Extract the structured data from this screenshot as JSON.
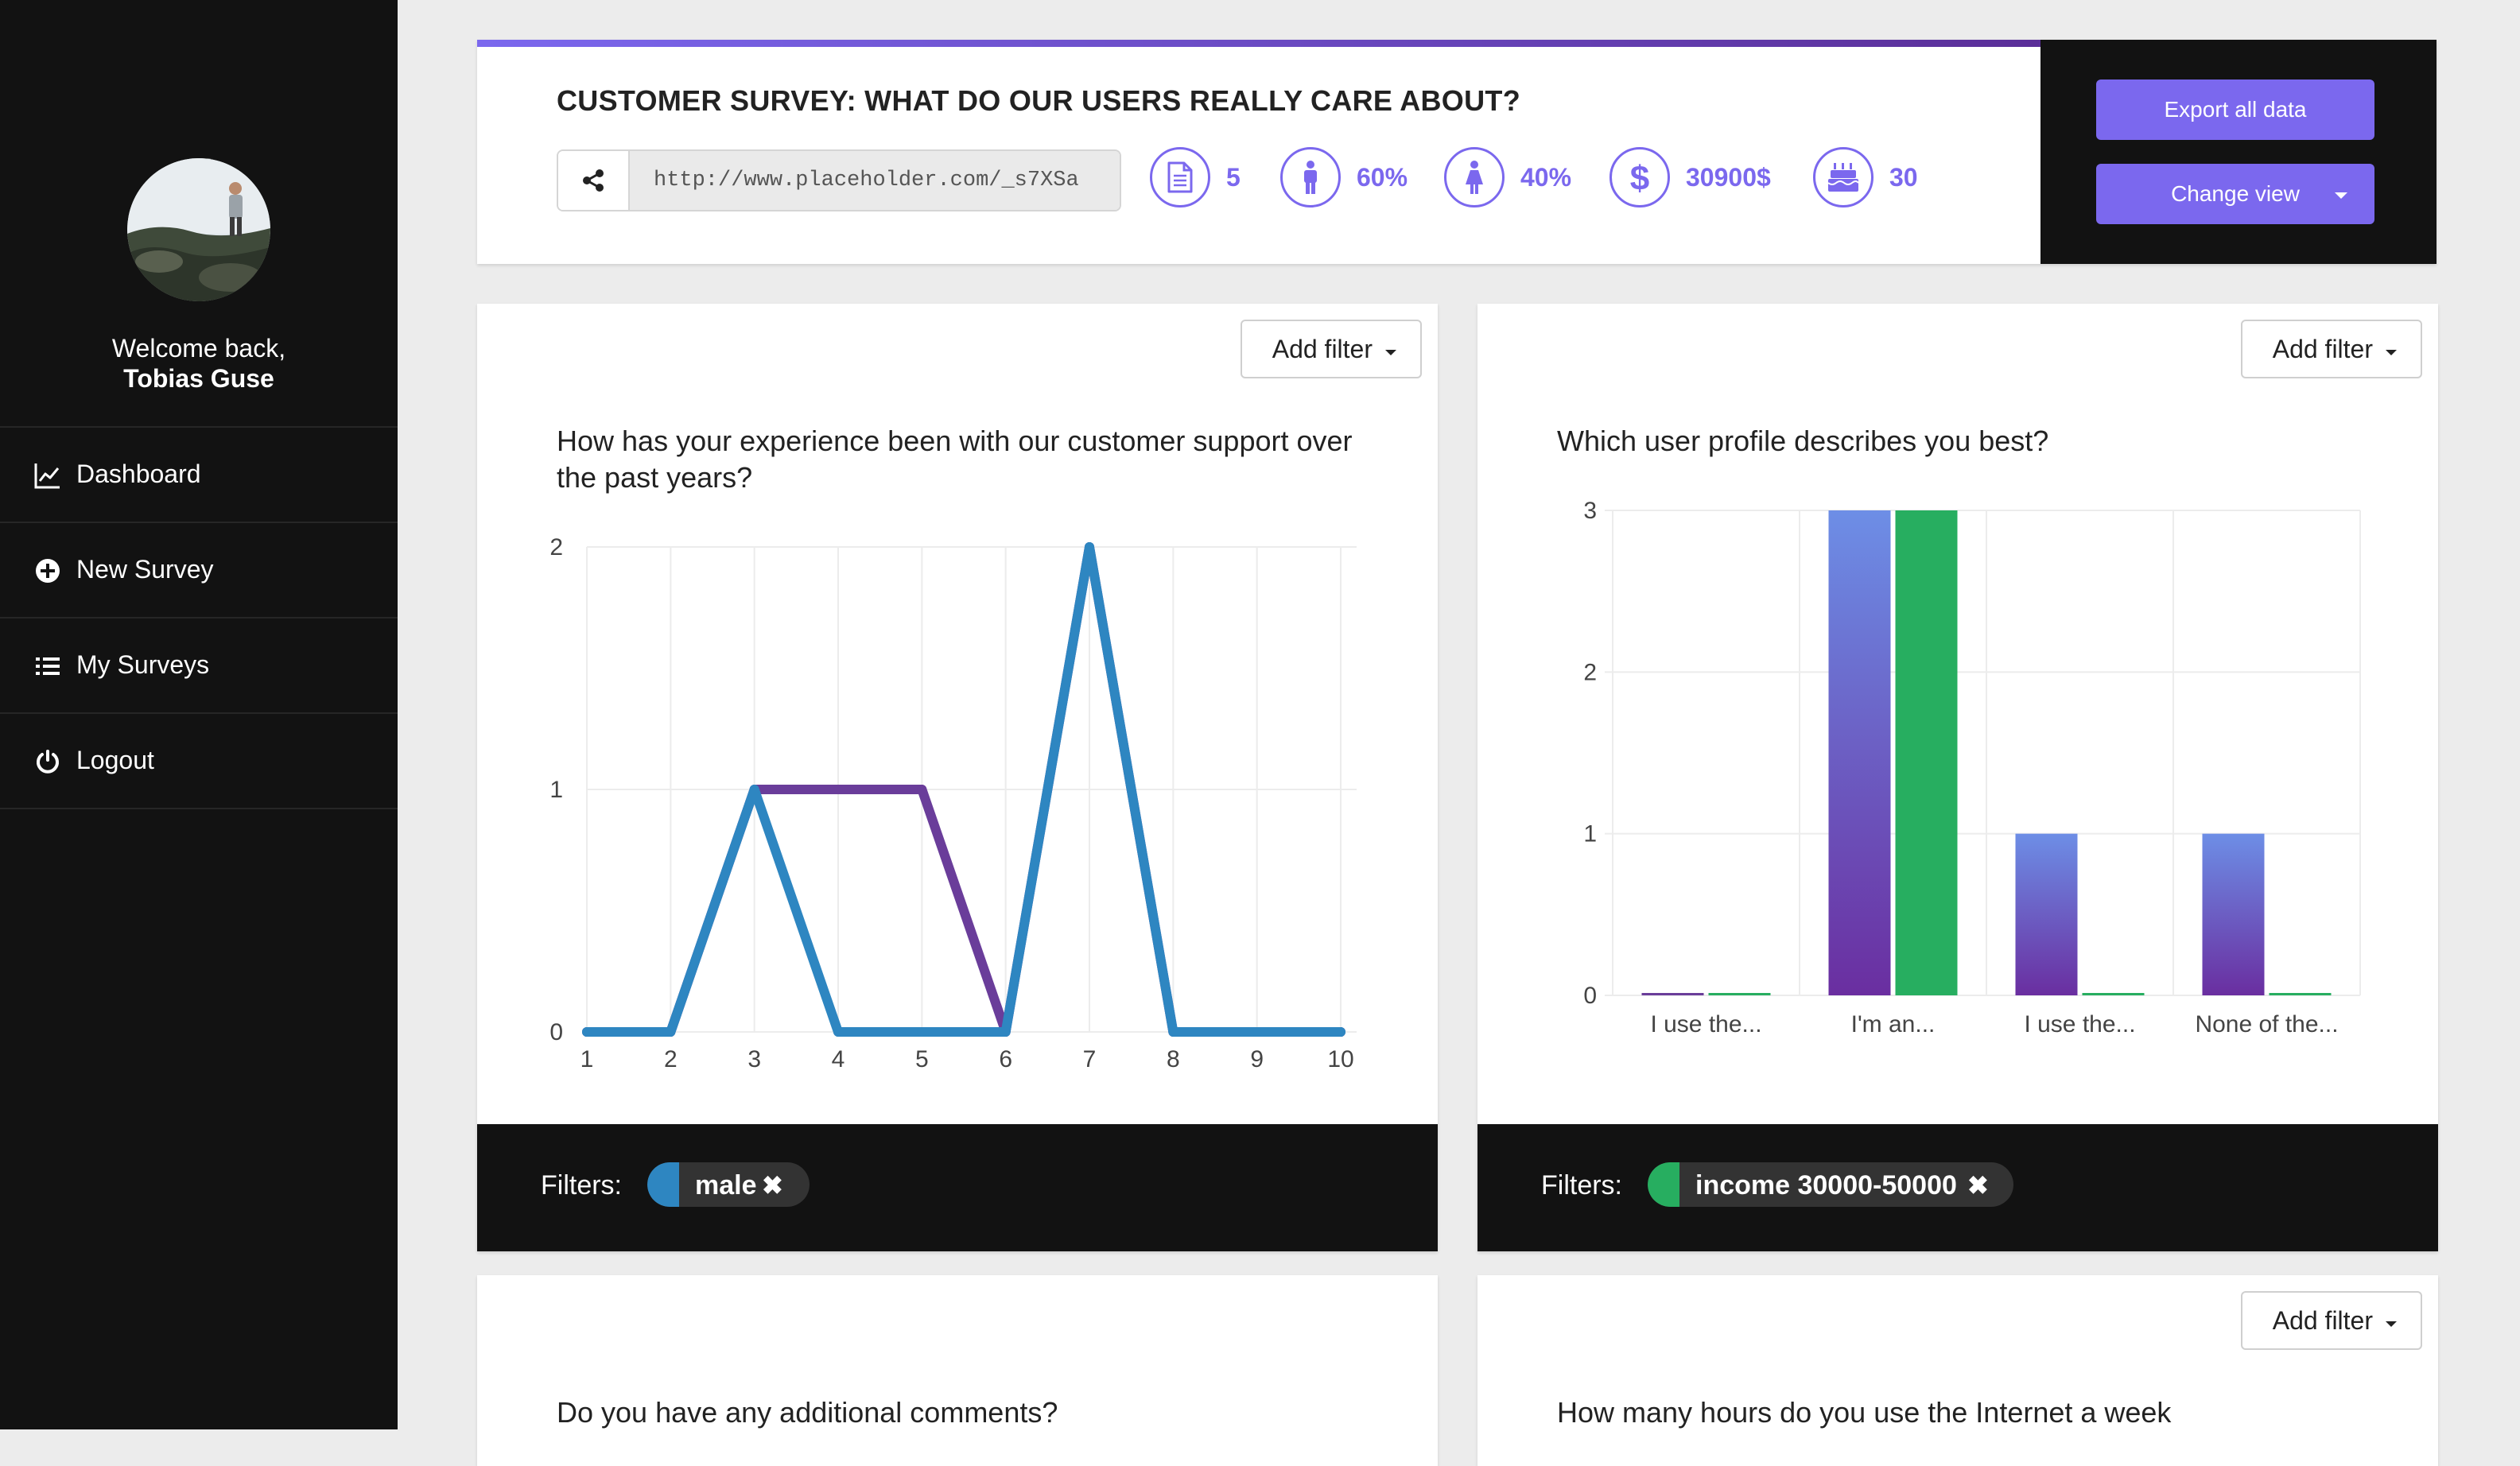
{
  "sidebar": {
    "welcome_line": "Welcome back,",
    "user_name": "Tobias Guse",
    "nav": [
      {
        "label": "Dashboard",
        "icon": "line-chart-icon"
      },
      {
        "label": "New Survey",
        "icon": "plus-circle-icon"
      },
      {
        "label": "My Surveys",
        "icon": "list-icon"
      },
      {
        "label": "Logout",
        "icon": "power-icon"
      }
    ]
  },
  "header": {
    "title": "CUSTOMER SURVEY: WHAT DO OUR USERS REALLY CARE ABOUT?",
    "share_url": "http://www.placeholder.com/_s7XSa",
    "stats": [
      {
        "icon": "document-icon",
        "value": "5"
      },
      {
        "icon": "male-icon",
        "value": "60%"
      },
      {
        "icon": "female-icon",
        "value": "40%"
      },
      {
        "icon": "dollar-icon",
        "value": "30900$"
      },
      {
        "icon": "birthday-cake-icon",
        "value": "30"
      }
    ],
    "export_label": "Export all data",
    "change_view_label": "Change view"
  },
  "colors": {
    "accent": "#7b68ee",
    "sidebar_bg": "#121212",
    "series_blue": "#2e86c1",
    "series_purple": "#6a3d9a",
    "series_green": "#27ae60"
  },
  "cards": {
    "add_filter_label": "Add filter",
    "filters_label": "Filters:",
    "card1": {
      "question": "How has your experience been with our customer support over the past years?",
      "filter_chip": "male",
      "filter_color": "#2e86c1"
    },
    "card2": {
      "question": "Which user profile describes you best?",
      "filter_chip": "income 30000-50000",
      "filter_color": "#27ae60"
    },
    "card3": {
      "question": "Do you have any additional comments?"
    },
    "card4": {
      "question": "How many hours do you use the Internet a week"
    }
  },
  "chart_data": [
    {
      "type": "line",
      "x": [
        1,
        2,
        3,
        4,
        5,
        6,
        7,
        8,
        9,
        10
      ],
      "series": [
        {
          "values": [
            0,
            0,
            1,
            1,
            1,
            0,
            2,
            0,
            0,
            0
          ],
          "color": "#6a3d9a"
        },
        {
          "values": [
            0,
            0,
            1,
            0,
            0,
            0,
            2,
            0,
            0,
            0
          ],
          "color": "#2e86c1"
        }
      ],
      "ylim": [
        0,
        2
      ],
      "yticks": [
        0,
        1,
        2
      ],
      "grid": true
    },
    {
      "type": "bar",
      "categories": [
        "I use the...",
        "I'm an...",
        "I use the...",
        "None of the..."
      ],
      "series": [
        {
          "values": [
            0,
            3,
            1,
            1
          ],
          "color": "#6a3d9a"
        },
        {
          "values": [
            0,
            3,
            0,
            0
          ],
          "color": "#27ae60"
        }
      ],
      "ylim": [
        0,
        3
      ],
      "yticks": [
        0,
        1,
        2,
        3
      ],
      "grid": true
    }
  ]
}
